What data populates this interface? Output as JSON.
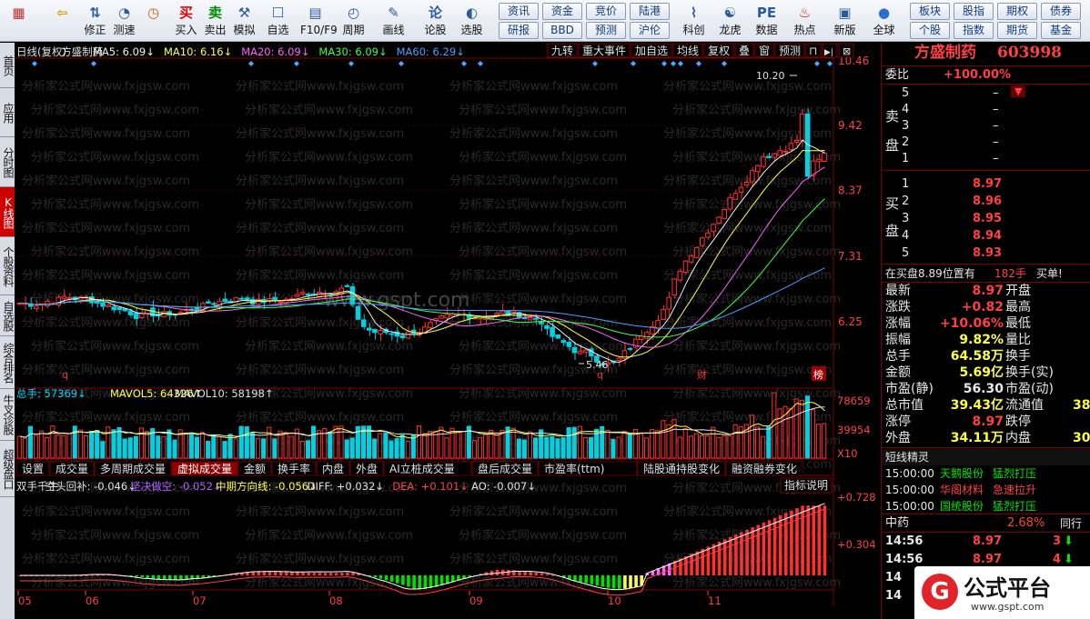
{
  "toolbar": {
    "items": [
      {
        "label": "",
        "icon": "app-logo-icon"
      },
      {
        "label": "",
        "icon": "back-arrow-icon"
      },
      {
        "label": "修正",
        "icon": "adjust-arrows-icon"
      },
      {
        "label": "测速",
        "icon": "speed-test-icon"
      },
      {
        "label": "",
        "icon": "clock-icon"
      },
      {
        "label": "买入",
        "icon": "buy-icon",
        "glyph": "买"
      },
      {
        "label": "卖出",
        "icon": "sell-icon",
        "glyph": "卖"
      },
      {
        "label": "模拟",
        "icon": "simulate-icon"
      },
      {
        "label": "自选",
        "icon": "favorites-icon"
      },
      {
        "label": "F10/F9",
        "icon": "f10-icon"
      },
      {
        "label": "周期",
        "icon": "period-icon"
      },
      {
        "label": "画线",
        "icon": "draw-line-icon"
      },
      {
        "label": "论股",
        "icon": "discuss-icon",
        "glyph": "论"
      },
      {
        "label": "选股",
        "icon": "stock-picker-icon"
      },
      {
        "label": "科创",
        "icon": "sci-tech-icon"
      },
      {
        "label": "龙虎",
        "icon": "dragon-tiger-icon"
      },
      {
        "label": "数据",
        "icon": "data-icon"
      },
      {
        "label": "热点",
        "icon": "hotspot-icon"
      },
      {
        "label": "新版",
        "icon": "new-version-icon"
      },
      {
        "label": "全球",
        "icon": "globe-icon"
      }
    ],
    "small_buttons": [
      "资讯",
      "资金",
      "竞价",
      "陆港",
      "研报",
      "BBD",
      "预测",
      "沪伦",
      "板块",
      "股指",
      "期权",
      "债券",
      "个股",
      "指数",
      "期货",
      "基金"
    ]
  },
  "side_tabs": [
    "首页",
    "应用",
    "分时图",
    "K线图",
    "个股资料",
    "自选股",
    "综合排名",
    "牛叉诊股",
    "超级盘口"
  ],
  "chart": {
    "legend": {
      "title": "日线(复权)",
      "stock": "方盛制药",
      "ma5": "MA5: 6.09↓",
      "ma10": "MA10: 6.16↓",
      "ma20": "MA20: 6.09↓",
      "ma30": "MA30: 6.09↓",
      "ma60": "MA60: 6.29↓"
    },
    "top_buttons": [
      "九转",
      "重大事件",
      "加自选",
      "均线",
      "复权",
      "叠",
      "窗",
      "预测"
    ],
    "price_ticks": [
      "10.46",
      "9.42",
      "8.37",
      "7.31",
      "6.25"
    ],
    "high_label": "10.20",
    "low_label": "5.46",
    "watermark": "分析家公式网www.fxjgsw.com",
    "center_watermark": "www.gspt.com",
    "event_marks": [
      "q",
      "q",
      "财",
      "榜"
    ],
    "volume": {
      "label1": "总手: 57369↓",
      "label2": "MAVOL5: 64326↑",
      "label3": "MAVOL10: 58198↑",
      "ticks": [
        "78659",
        "39954",
        "X10"
      ]
    },
    "tabs": [
      "设置",
      "成交量",
      "多周期成交量",
      "虚拟成交量",
      "金额",
      "换手率",
      "内盘",
      "外盘",
      "AI立桩成交量",
      "盘后成交量",
      "市盈率(ttm)",
      "陆股通持股变化",
      "融资融券变化"
    ],
    "active_tab": "虚拟成交量",
    "indicator": {
      "name": "双手千牛",
      "l1": "空头回补: -0.046↓",
      "l2": "坚决做空: -0.052↓",
      "l3": "中期方向线: -0.056↓",
      "l4": "DIFF: +0.032↓",
      "l5": "DEA: +0.101↓",
      "l6": "AO: -0.007↓",
      "button": "指标说明",
      "ticks": [
        "+0.728",
        "+0.304"
      ]
    },
    "months": [
      "05",
      "06",
      "07",
      "08",
      "09",
      "10",
      "11"
    ]
  },
  "quote": {
    "name": "方盛制药",
    "code": "603998",
    "weibi_label": "委比",
    "weibi": "+100.00%",
    "sell_label": "卖盘",
    "buy_label": "买盘",
    "sells": [
      {
        "n": "5",
        "p": "–"
      },
      {
        "n": "4",
        "p": "–"
      },
      {
        "n": "3",
        "p": "–"
      },
      {
        "n": "2",
        "p": "–"
      },
      {
        "n": "1",
        "p": "–"
      }
    ],
    "buys": [
      {
        "n": "1",
        "p": "8.97"
      },
      {
        "n": "2",
        "p": "8.96"
      },
      {
        "n": "3",
        "p": "8.95"
      },
      {
        "n": "4",
        "p": "8.94"
      },
      {
        "n": "5",
        "p": "8.93"
      }
    ],
    "queue": {
      "text": "在买盘8.89位置有",
      "vol": "182手",
      "act": "买单!"
    },
    "stats": [
      {
        "l": "最新",
        "v": "8.97",
        "l2": "开盘",
        "c": "red"
      },
      {
        "l": "涨跌",
        "v": "+0.82",
        "l2": "最高",
        "c": "red"
      },
      {
        "l": "涨幅",
        "v": "+10.06%",
        "l2": "最低",
        "c": "red"
      },
      {
        "l": "振幅",
        "v": "9.82%",
        "l2": "量比",
        "c": "yel"
      },
      {
        "l": "总手",
        "v": "64.58万",
        "l2": "换手",
        "c": "yel"
      },
      {
        "l": "金额",
        "v": "5.69亿",
        "l2": "换手(实)",
        "c": "yel"
      },
      {
        "l": "市盈(静)",
        "v": "56.30",
        "l2": "市盈(动)",
        "c": "wht"
      },
      {
        "l": "总市值",
        "v": "39.43亿",
        "l2": "流通值",
        "c": "yel",
        "extra": "38"
      },
      {
        "l": "涨停",
        "v": "8.97",
        "l2": "跌停",
        "c": "red"
      },
      {
        "l": "外盘",
        "v": "34.11万",
        "l2": "内盘",
        "c": "yel",
        "extra": "30"
      }
    ],
    "sprite_title": "短线精灵",
    "sprites": [
      {
        "t": "15:00:00",
        "s": "天鹅股份",
        "e": "猛烈打压"
      },
      {
        "t": "15:00:00",
        "s": "华阁材料",
        "e": "急速拉升"
      },
      {
        "t": "15:00:00",
        "s": "国统股份",
        "e": "猛烈打压"
      }
    ],
    "sector": {
      "name": "中药",
      "pct": "2.68%",
      "label": "同行"
    },
    "ticks": [
      {
        "t": "14:56",
        "p": "8.97",
        "v": "3"
      },
      {
        "t": "14:56",
        "p": "8.97",
        "v": "4"
      },
      {
        "t": "14",
        "p": "",
        "v": ""
      },
      {
        "t": "14",
        "p": "",
        "v": ""
      }
    ],
    "badge_text": "公式平台",
    "badge_url": "www.gspt.com"
  }
}
